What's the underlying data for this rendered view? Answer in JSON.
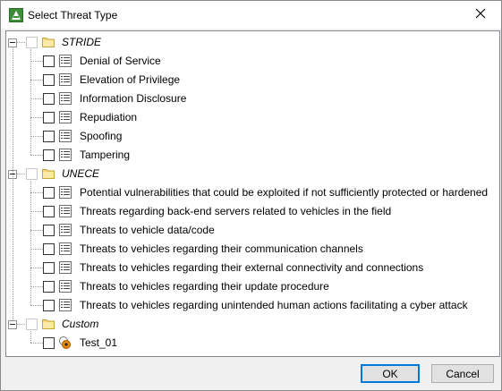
{
  "window": {
    "title": "Select Threat Type"
  },
  "tree": {
    "groups": [
      {
        "label": "STRIDE",
        "items": [
          {
            "label": "Denial of Service",
            "checked": false
          },
          {
            "label": "Elevation of Privilege",
            "checked": false
          },
          {
            "label": "Information Disclosure",
            "checked": false
          },
          {
            "label": "Repudiation",
            "checked": false
          },
          {
            "label": "Spoofing",
            "checked": false
          },
          {
            "label": "Tampering",
            "checked": false
          }
        ]
      },
      {
        "label": "UNECE",
        "items": [
          {
            "label": "Potential vulnerabilities that could be exploited if not sufficiently protected or hardened",
            "checked": false
          },
          {
            "label": "Threats regarding back-end servers related to vehicles in the field",
            "checked": false
          },
          {
            "label": "Threats to vehicle data/code",
            "checked": false
          },
          {
            "label": "Threats to vehicles regarding their communication channels",
            "checked": false
          },
          {
            "label": "Threats to vehicles regarding their external connectivity and connections",
            "checked": false
          },
          {
            "label": "Threats to vehicles regarding their update procedure",
            "checked": false
          },
          {
            "label": "Threats to vehicles regarding unintended human actions facilitating a cyber attack",
            "checked": false
          }
        ]
      },
      {
        "label": "Custom",
        "items": [
          {
            "label": "Test_01",
            "checked": false,
            "icon": "custom-threat-icon"
          }
        ]
      }
    ]
  },
  "buttons": {
    "ok": "OK",
    "cancel": "Cancel"
  },
  "colors": {
    "folder": "#f4d77a",
    "folder_border": "#c9a43c",
    "custom_icon": "#f08a00"
  }
}
